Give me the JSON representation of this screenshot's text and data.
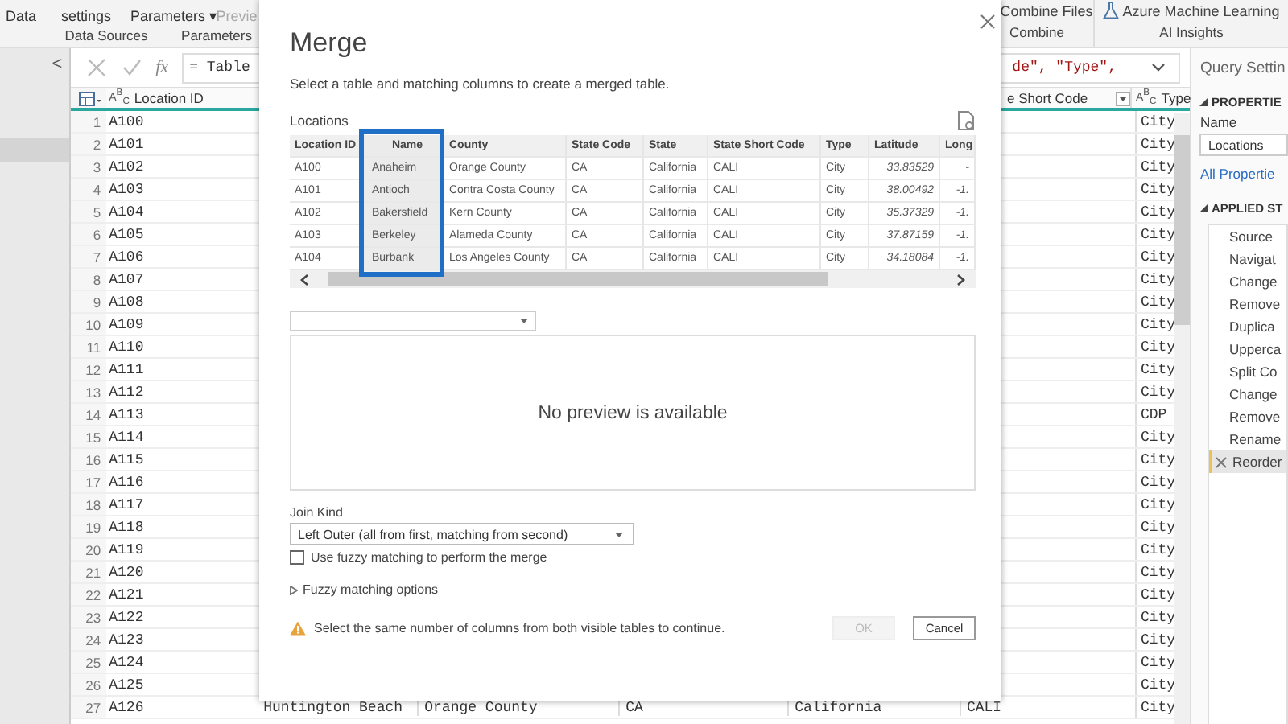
{
  "ribbon": {
    "left_items": [
      {
        "label": "Data",
        "disabled": false
      },
      {
        "label": "settings",
        "disabled": false
      },
      {
        "label": "Parameters ▾",
        "disabled": false
      },
      {
        "label": "Previe",
        "disabled": true
      }
    ],
    "left_groups": [
      "Data Sources",
      "Parameters"
    ],
    "right_items": [
      {
        "label": "Combine Files",
        "group": "Combine",
        "kind": "files"
      },
      {
        "label": "Azure Machine Learning",
        "group": "AI Insights",
        "kind": "flask"
      }
    ]
  },
  "sidebar": {
    "collapse_label": "<"
  },
  "formula_bar": {
    "function_label": "fx",
    "text_left": "= Table",
    "text_right": "de\", \"Type\","
  },
  "grid": {
    "columns": [
      {
        "label": "Location ID",
        "type_icon": "A$^{B}$$_{C}$"
      },
      {
        "label": "e Short Code"
      },
      {
        "label": "Type",
        "type_icon": "A$^{B}$$_{C}$"
      }
    ],
    "rows": [
      {
        "number": "1",
        "location_id": "A100",
        "type": "City"
      },
      {
        "number": "2",
        "location_id": "A101",
        "type": "City"
      },
      {
        "number": "3",
        "location_id": "A102",
        "type": "City"
      },
      {
        "number": "4",
        "location_id": "A103",
        "type": "City"
      },
      {
        "number": "5",
        "location_id": "A104",
        "type": "City"
      },
      {
        "number": "6",
        "location_id": "A105",
        "type": "City"
      },
      {
        "number": "7",
        "location_id": "A106",
        "type": "City"
      },
      {
        "number": "8",
        "location_id": "A107",
        "type": "City"
      },
      {
        "number": "9",
        "location_id": "A108",
        "type": "City"
      },
      {
        "number": "10",
        "location_id": "A109",
        "type": "City"
      },
      {
        "number": "11",
        "location_id": "A110",
        "type": "City"
      },
      {
        "number": "12",
        "location_id": "A111",
        "type": "City"
      },
      {
        "number": "13",
        "location_id": "A112",
        "type": "City"
      },
      {
        "number": "14",
        "location_id": "A113",
        "type": "CDP"
      },
      {
        "number": "15",
        "location_id": "A114",
        "type": "City"
      },
      {
        "number": "16",
        "location_id": "A115",
        "type": "City"
      },
      {
        "number": "17",
        "location_id": "A116",
        "type": "City"
      },
      {
        "number": "18",
        "location_id": "A117",
        "type": "City"
      },
      {
        "number": "19",
        "location_id": "A118",
        "type": "City"
      },
      {
        "number": "20",
        "location_id": "A119",
        "type": "City"
      },
      {
        "number": "21",
        "location_id": "A120",
        "type": "City"
      },
      {
        "number": "22",
        "location_id": "A121",
        "type": "City"
      },
      {
        "number": "23",
        "location_id": "A122",
        "type": "City"
      },
      {
        "number": "24",
        "location_id": "A123",
        "type": "City"
      },
      {
        "number": "25",
        "location_id": "A124",
        "type": "City"
      },
      {
        "number": "26",
        "location_id": "A125",
        "type": "City"
      },
      {
        "number": "27",
        "location_id": "A126",
        "middle": [
          "Huntington Beach",
          "Orange County",
          "CA",
          "California"
        ],
        "state_short_code": "CALI",
        "type": "City"
      }
    ]
  },
  "query_settings": {
    "title": "Query Settin",
    "properties_label": "PROPERTIE",
    "name_label": "Name",
    "name_value": "Locations",
    "all_properties_link": "All Propertie",
    "applied_steps_label": "APPLIED ST",
    "steps": [
      {
        "label": "Source",
        "selected": false
      },
      {
        "label": "Navigat",
        "selected": false
      },
      {
        "label": "Change",
        "selected": false
      },
      {
        "label": "Remove",
        "selected": false
      },
      {
        "label": "Duplica",
        "selected": false
      },
      {
        "label": "Upperca",
        "selected": false
      },
      {
        "label": "Split Co",
        "selected": false
      },
      {
        "label": "Change",
        "selected": false
      },
      {
        "label": "Remove",
        "selected": false
      },
      {
        "label": "Rename",
        "selected": false
      },
      {
        "label": "Reorder",
        "selected": true
      }
    ]
  },
  "dialog": {
    "title": "Merge",
    "subtitle": "Select a table and matching columns to create a merged table.",
    "table_label": "Locations",
    "table": {
      "columns": [
        {
          "label": "Location ID",
          "selected": false
        },
        {
          "label": "Name",
          "selected": true
        },
        {
          "label": "County",
          "selected": false
        },
        {
          "label": "State Code",
          "selected": false
        },
        {
          "label": "State",
          "selected": false
        },
        {
          "label": "State Short Code",
          "selected": false
        },
        {
          "label": "Type",
          "selected": false
        },
        {
          "label": "Latitude",
          "selected": false
        },
        {
          "label": "Long",
          "selected": false
        }
      ],
      "rows": [
        [
          "A100",
          "Anaheim",
          "Orange County",
          "CA",
          "California",
          "CALI",
          "City",
          "33.83529",
          "-"
        ],
        [
          "A101",
          "Antioch",
          "Contra Costa County",
          "CA",
          "California",
          "CALI",
          "City",
          "38.00492",
          "-1."
        ],
        [
          "A102",
          "Bakersfield",
          "Kern County",
          "CA",
          "California",
          "CALI",
          "City",
          "35.37329",
          "-1."
        ],
        [
          "A103",
          "Berkeley",
          "Alameda County",
          "CA",
          "California",
          "CALI",
          "City",
          "37.87159",
          "-1."
        ],
        [
          "A104",
          "Burbank",
          "Los Angeles County",
          "CA",
          "California",
          "CALI",
          "City",
          "34.18084",
          "-1."
        ]
      ]
    },
    "preview_message": "No preview is available",
    "join_kind_label": "Join Kind",
    "join_kind_value": "Left Outer (all from first, matching from second)",
    "fuzzy_checkbox": {
      "label": "Use fuzzy matching to perform the merge",
      "checked": false
    },
    "fuzzy_options": {
      "label": "Fuzzy matching options",
      "expanded": false
    },
    "warning": "Select the same number of columns from both visible tables to continue.",
    "buttons": [
      {
        "label": "OK",
        "disabled": true
      },
      {
        "label": "Cancel",
        "disabled": false
      }
    ]
  }
}
